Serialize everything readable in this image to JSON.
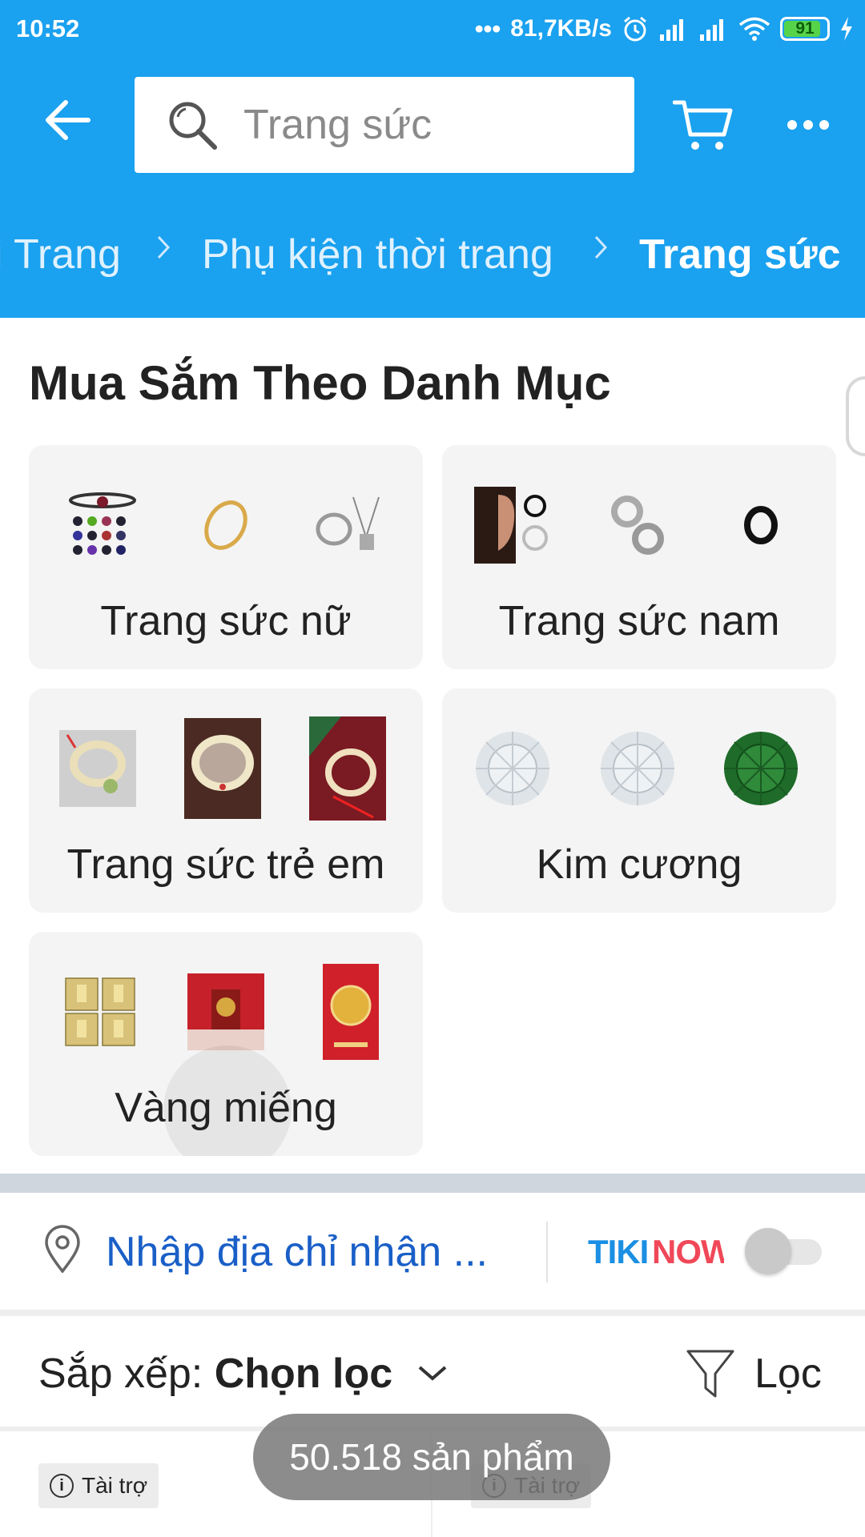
{
  "status_bar": {
    "time": "10:52",
    "net_speed": "81,7KB/s",
    "battery": "91"
  },
  "header": {
    "search_placeholder": "Trang sức"
  },
  "breadcrumb": {
    "items": [
      "i Trang",
      "Phụ kiện thời trang",
      "Trang sức"
    ]
  },
  "categories": {
    "title": "Mua Sắm Theo Danh Mục",
    "items": [
      {
        "label": "Trang sức nữ"
      },
      {
        "label": "Trang sức nam"
      },
      {
        "label": "Trang sức trẻ em"
      },
      {
        "label": "Kim cương"
      },
      {
        "label": "Vàng miếng"
      }
    ]
  },
  "address": {
    "text": "Nhập địa chỉ nhận ...",
    "tikinow_logo": "TIKINOW"
  },
  "sort": {
    "prefix": "Sắp xếp:",
    "value": "Chọn lọc",
    "filter_label": "Lọc"
  },
  "products": {
    "sponsor_label": "Tài trợ"
  },
  "toast": {
    "text": "50.518 sản phẩm"
  },
  "colors": {
    "header_bg": "#1aa1ef",
    "link_blue": "#1a5fc7",
    "card_bg": "#f4f4f4"
  }
}
